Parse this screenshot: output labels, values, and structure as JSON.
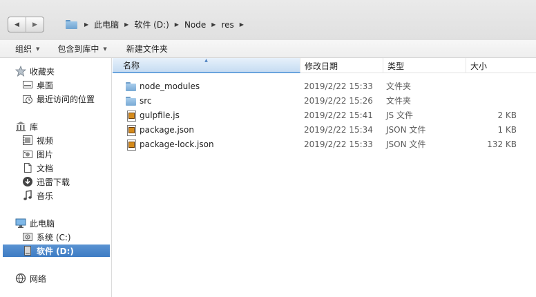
{
  "breadcrumb": [
    "此电脑",
    "软件 (D:)",
    "Node",
    "res"
  ],
  "toolbar": {
    "organize": "组织",
    "include_in_library": "包含到库中",
    "new_folder": "新建文件夹"
  },
  "sidebar": {
    "favorites": {
      "label": "收藏夹",
      "items": [
        "桌面",
        "最近访问的位置"
      ]
    },
    "libraries": {
      "label": "库",
      "items": [
        "视频",
        "图片",
        "文档",
        "迅雷下载",
        "音乐"
      ]
    },
    "computer": {
      "label": "此电脑",
      "items": [
        "系统 (C:)",
        "软件 (D:)"
      ],
      "selected": "软件 (D:)"
    },
    "network": {
      "label": "网络"
    }
  },
  "columns": {
    "name": "名称",
    "date": "修改日期",
    "type": "类型",
    "size": "大小"
  },
  "files": [
    {
      "name": "node_modules",
      "date": "2019/2/22 15:33",
      "type": "文件夹",
      "size": "",
      "icon": "folder-icon"
    },
    {
      "name": "src",
      "date": "2019/2/22 15:26",
      "type": "文件夹",
      "size": "",
      "icon": "folder-icon"
    },
    {
      "name": "gulpfile.js",
      "date": "2019/2/22 15:41",
      "type": "JS 文件",
      "size": "2 KB",
      "icon": "js-file-icon"
    },
    {
      "name": "package.json",
      "date": "2019/2/22 15:34",
      "type": "JSON 文件",
      "size": "1 KB",
      "icon": "json-file-icon"
    },
    {
      "name": "package-lock.json",
      "date": "2019/2/22 15:33",
      "type": "JSON 文件",
      "size": "132 KB",
      "icon": "json-file-icon"
    }
  ],
  "colors": {
    "selection": "#3e7cc4",
    "folder": "#78a9d4",
    "sorted_header": "#c6dcf2"
  }
}
